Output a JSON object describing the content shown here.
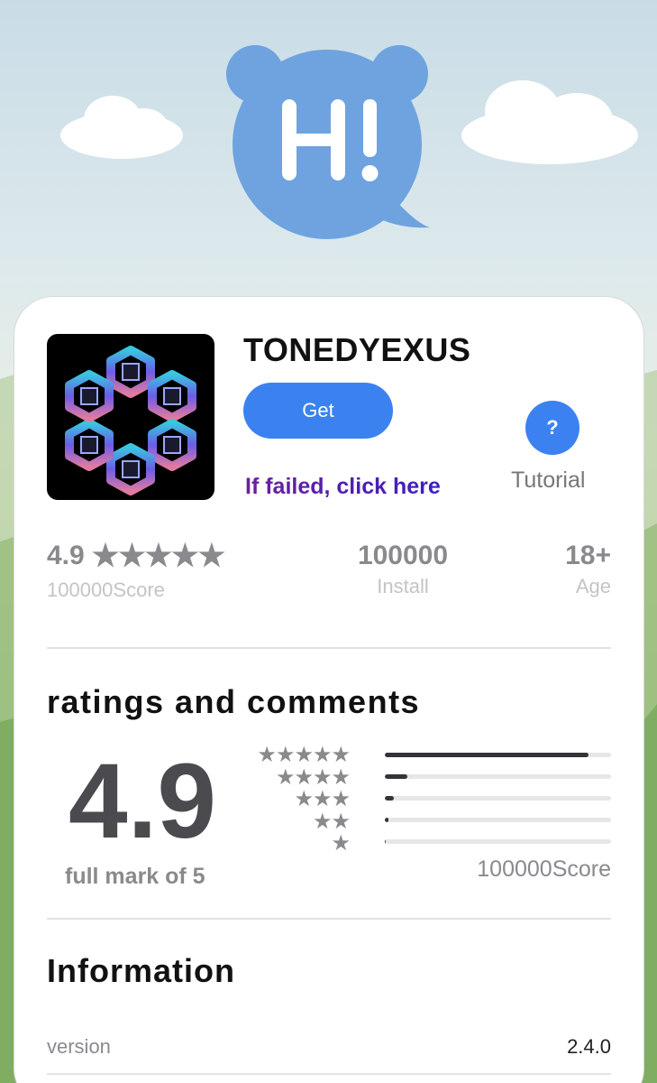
{
  "app": {
    "name": "TONEDYEXUS",
    "get_label": "Get",
    "failed_link": "If failed, click here",
    "help_symbol": "?",
    "tutorial_label": "Tutorial"
  },
  "stats": {
    "rating": "4.9",
    "rating_stars": "★★★★★",
    "rating_sub": "100000Score",
    "installs": "100000",
    "installs_label": "Install",
    "age": "18+",
    "age_label": "Age"
  },
  "ratings": {
    "title": "ratings and comments",
    "score": "4.9",
    "full_mark": "full mark of 5",
    "star_rows": [
      "★★★★★",
      "★★★★",
      "★★★",
      "★★",
      "★"
    ],
    "bar_fractions": [
      0.9,
      0.1,
      0.04,
      0.015,
      0.005
    ],
    "score_count": "100000Score"
  },
  "information": {
    "title": "Information",
    "rows": [
      {
        "label": "version",
        "value": "2.4.0"
      }
    ]
  },
  "colors": {
    "accent": "#3b82f0",
    "mascot": "#6ea3e0"
  },
  "icons": {
    "mascot": "hi-bubble-mascot-icon",
    "app": "hexagon-cubes-logo-icon"
  }
}
